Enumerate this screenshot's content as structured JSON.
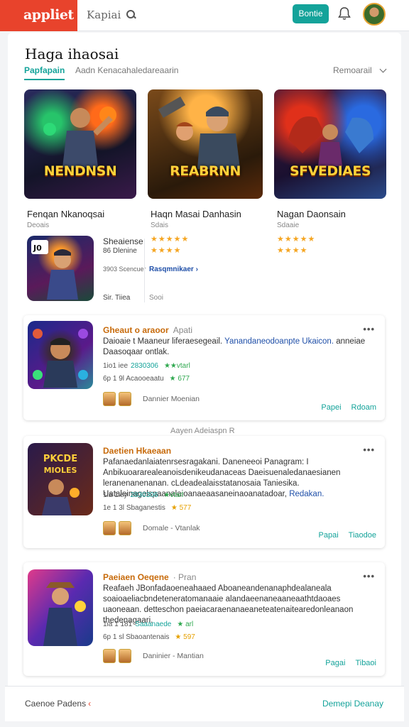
{
  "header": {
    "logo": "appliet",
    "search_text": "Kapiai",
    "action_button": "Bontie"
  },
  "page": {
    "title": "Haga ihaosai",
    "tab_active": "Papfapain",
    "tab_secondary": "Aadn Kenacahaledareaarin",
    "sort_label": "Remoarail"
  },
  "featured": [
    {
      "art_title": "NENDNSN",
      "name": "Fenqan Nkanoqsai",
      "sub": "Deoais",
      "stars_orange": "★★★★★",
      "stars_green": ""
    },
    {
      "art_title": "REABRNN",
      "name": "Haqn Masai Danhasin",
      "sub": "Sdais",
      "stars_orange": "★★★★★",
      "stars_green": "★★★★"
    },
    {
      "art_title": "SFVEDIAES",
      "name": "Nagan Daonsain",
      "sub": "Sdaaie",
      "stars_orange": "★★★★★",
      "stars_green": "★★★★"
    }
  ],
  "mini": {
    "title": "Sheaiense",
    "sub": "86 Dlenine",
    "stat": "3903 Scencuer",
    "link": "Rasqmnikaer",
    "foot_left": "Sir. Tiiea",
    "foot_right": "Sooi"
  },
  "cards": [
    {
      "title": "Gheaut o araoor",
      "meta": "Apati",
      "desc_pre": "Daioaie t Maaneur liferaesegeail.",
      "desc_hl": "Yanandaneodoanpte Ukaicon.",
      "desc_post": "anneiae Daasoqaar ontlak.",
      "stat1": "1io1 iee",
      "stat_g": "2830306",
      "stat_s": "★★vtarl",
      "stat2": "6p 1 9l",
      "stat3": "Acaooeaatu",
      "stat_y": "★ 677",
      "user": "Dannier Moenian",
      "action1": "Papei",
      "action2": "Rdoam"
    },
    {
      "title": "Daetien Hkaeaan",
      "meta": "",
      "desc_pre": "Pafanaedanlaiatenrsesragakani. Daneneeoi Panagram: I Anbikuoararealeanoisdenikeudanaceas Daeisuenaledanaesianen leranenanenanan. cLdeadealaisstatanosaia Taniesika. Uataleinagelspaanalaioanaeaasaneinaoanatadoar,",
      "desc_hl": "Redakan.",
      "desc_post": "",
      "stat1": "1ia 1iey",
      "stat_g": "2830306",
      "stat_s": "★vtarl",
      "stat2": "1e 1 3l",
      "stat3": "Sbaganestis",
      "stat_y": "★ 577",
      "user": "Domale - Vtanlak",
      "action1": "Papai",
      "action2": "Tiaodoe"
    },
    {
      "title": "Paeiaen Oeqene",
      "meta": "· Pran",
      "desc_pre": "Reafaeh JBonfadaoeneahaaed Aboaneandenanaphdealaneala soaioaeliacbndeteneratomanaaie alandaeenaneaaneaathtdaoaes uaoneaan.",
      "desc_hl": "",
      "desc_post": "detteschon paeiacaraenanaeaneteatenaitearedonleanaon thedenagaari.",
      "stat1": "1ia 1 181",
      "stat_g": "Saaanaede",
      "stat_s": "★ arl",
      "stat2": "6p 1 sl",
      "stat3": "Sbaoantenais",
      "stat_y": "★ 597",
      "user": "Daninier - Mantian",
      "action1": "Pagai",
      "action2": "Tibaoi"
    }
  ],
  "floating_label": "Aayen Adeiaspn R",
  "footer": {
    "left": "Caenoe Padens",
    "left_mark": "‹",
    "right": "Demepi Deanay"
  },
  "colors": {
    "brand": "#e8432c",
    "accent": "#14a39a",
    "link": "#1f4fa8",
    "star": "#f5a623",
    "star_green": "#2fa84f"
  }
}
